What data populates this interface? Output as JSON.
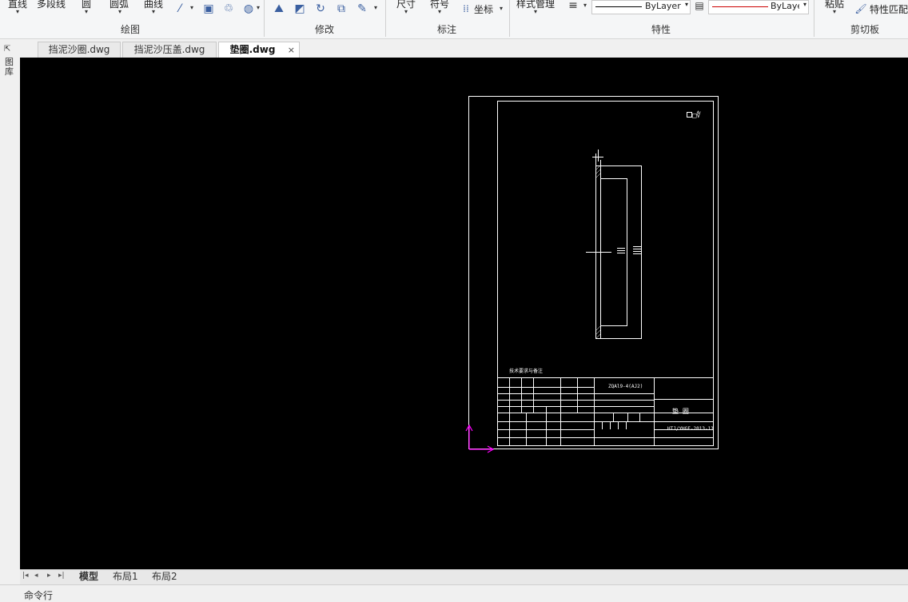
{
  "ribbon": {
    "draw": {
      "title": "绘图",
      "line": "直线",
      "polyline": "多段线",
      "circle": "圆",
      "arc": "圆弧",
      "curve": "曲线"
    },
    "modify": {
      "title": "修改"
    },
    "annotate": {
      "title": "标注",
      "dimension": "尺寸",
      "symbol": "符号",
      "coordinate": "坐标"
    },
    "properties": {
      "title": "特性",
      "style_manager": "样式管理",
      "linetype_value": "ByLayer",
      "color_value": "ByLayer"
    },
    "clipboard": {
      "title": "剪切板",
      "paste": "粘贴",
      "match_props": "特性匹配"
    }
  },
  "tabs": [
    {
      "label": "挡泥沙圈.dwg"
    },
    {
      "label": "挡泥沙压盖.dwg"
    },
    {
      "label": "垫圈.dwg",
      "close": "×"
    }
  ],
  "left_strip": {
    "label": "图库"
  },
  "drawing": {
    "tech_note": "技术要求与备注",
    "material": "ZQAl9-4(AJ2)",
    "part_name": "垫 圈",
    "drawing_no": "HTJ/YHGF-2013-13",
    "roughness_mark": "□∜"
  },
  "layout_tabs": [
    "模型",
    "布局1",
    "布局2"
  ],
  "command_line": "命令行",
  "colors": {
    "canvas": "#000000",
    "ucs": "#ff00ff",
    "linetype_color": "#cc0000"
  }
}
